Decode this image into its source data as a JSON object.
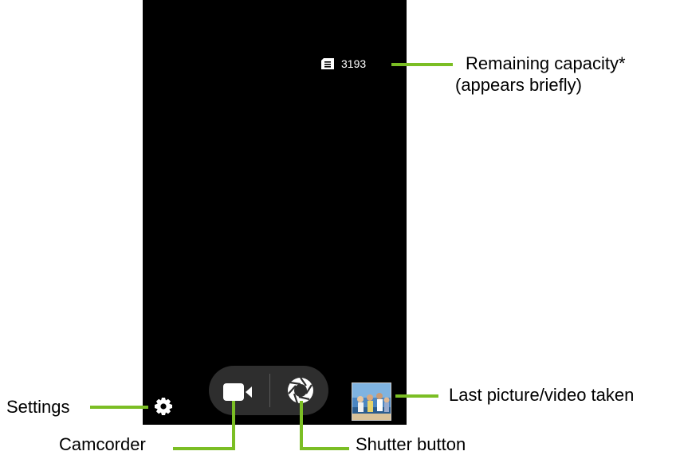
{
  "screen": {
    "capacity_count": "3193",
    "icons": [
      "sd-card-icon",
      "camcorder-icon",
      "shutter-icon",
      "settings-icon"
    ],
    "last_capture_thumbnail": "photo of people on a beach"
  },
  "callouts": {
    "remaining_capacity": "Remaining capacity*",
    "remaining_capacity_note": "(appears briefly)",
    "settings": "Settings",
    "camcorder": "Camcorder",
    "shutter_button": "Shutter button",
    "last_picture": "Last picture/video taken"
  },
  "colors": {
    "callout_line": "#7bbe24",
    "screen_background": "#000000",
    "control_pill": "#2e2e2e"
  }
}
